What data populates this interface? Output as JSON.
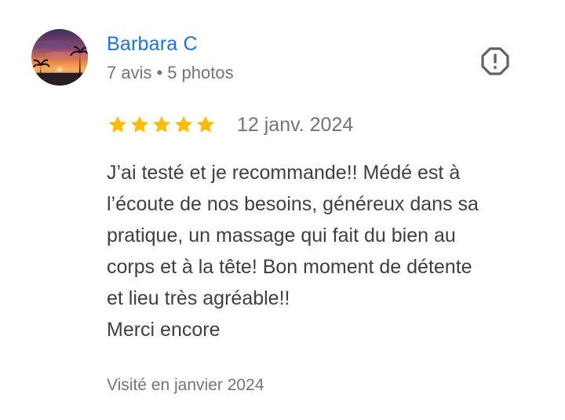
{
  "review": {
    "author": {
      "name": "Barbara C",
      "reviews_count": "7 avis",
      "separator": "•",
      "photos_count": "5 photos"
    },
    "report_icon": "report-flag-icon",
    "rating": 5,
    "max_rating": 5,
    "date": "12 janv. 2024",
    "text_lines": [
      "J’ai testé et je recommande!! Médé est à",
      "l’écoute de nos besoins, généreux dans sa",
      "pratique, un massage qui fait du bien au",
      "corps et à la tête! Bon moment de détente",
      "et lieu très agréable!!",
      "Merci encore"
    ],
    "visit": "Visité en janvier 2024"
  },
  "colors": {
    "author_link": "#1a73e8",
    "secondary_text": "#70757a",
    "body_text": "#3c4043",
    "star": "#fbbc04",
    "report_icon": "#5f6368"
  }
}
